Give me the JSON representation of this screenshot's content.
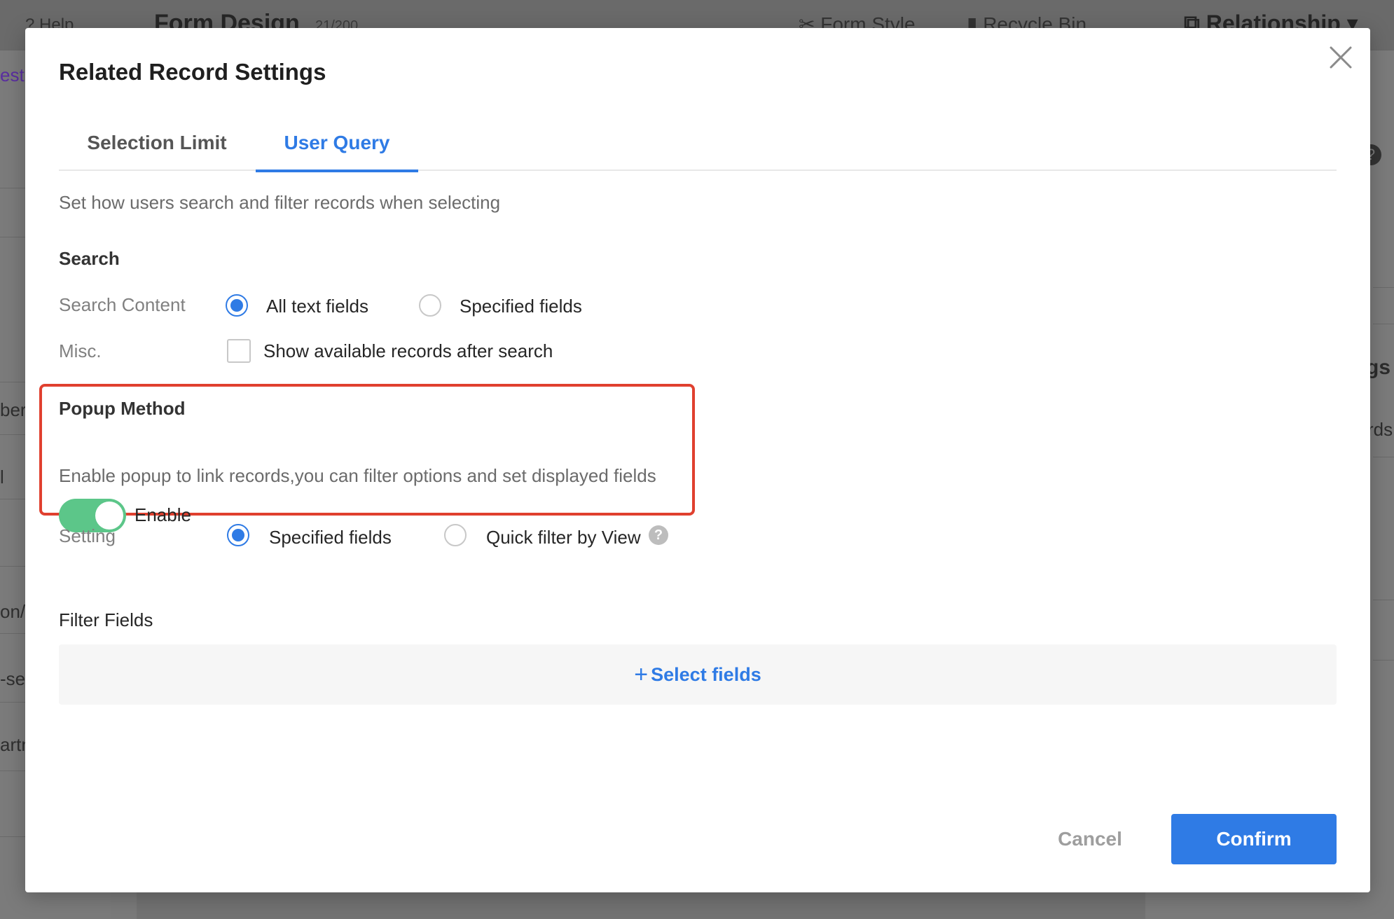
{
  "background": {
    "help": "Help",
    "form_design": "Form Design",
    "field_count": "21/200",
    "form_style": "Form Style",
    "recycle_bin": "Recycle Bin",
    "relationship": "Relationship",
    "left_items": [
      "est",
      "ber",
      "l",
      "on/",
      "-se",
      "artn"
    ],
    "right_items": [
      "gs",
      "rds"
    ]
  },
  "modal": {
    "title": "Related Record Settings",
    "tabs": [
      {
        "label": "Selection Limit",
        "active": false
      },
      {
        "label": "User Query",
        "active": true
      }
    ],
    "description": "Set how users search and filter records when selecting",
    "search": {
      "title": "Search",
      "content_label": "Search Content",
      "content_options": [
        {
          "label": "All text fields",
          "checked": true
        },
        {
          "label": "Specified fields",
          "checked": false
        }
      ],
      "misc_label": "Misc.",
      "misc_option": "Show available records after search"
    },
    "popup": {
      "title": "Popup Method",
      "description": "Enable popup to link records,you can filter options and set displayed fields",
      "toggle_label": "Enable",
      "toggle_on": true,
      "setting_label": "Setting",
      "setting_options": [
        {
          "label": "Specified fields",
          "checked": true
        },
        {
          "label": "Quick filter by View",
          "checked": false
        }
      ]
    },
    "filter_fields_label": "Filter Fields",
    "select_fields": "Select fields",
    "cancel": "Cancel",
    "confirm": "Confirm"
  },
  "colors": {
    "accent": "#2f7be5",
    "toggle": "#5cc689",
    "highlight": "#e0402f"
  }
}
